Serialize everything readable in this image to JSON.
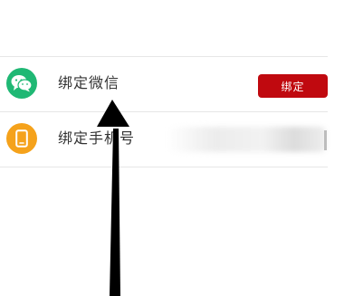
{
  "colors": {
    "wechat_green": "#1fb874",
    "phone_orange": "#f5a21b",
    "bind_red": "#c0090f",
    "annotation_arrow": "#000000"
  },
  "rows": [
    {
      "icon": "wechat-icon",
      "label": "绑定微信",
      "action_label": "绑定"
    },
    {
      "icon": "phone-icon",
      "label": "绑定手机号",
      "value_obscured": true
    }
  ]
}
